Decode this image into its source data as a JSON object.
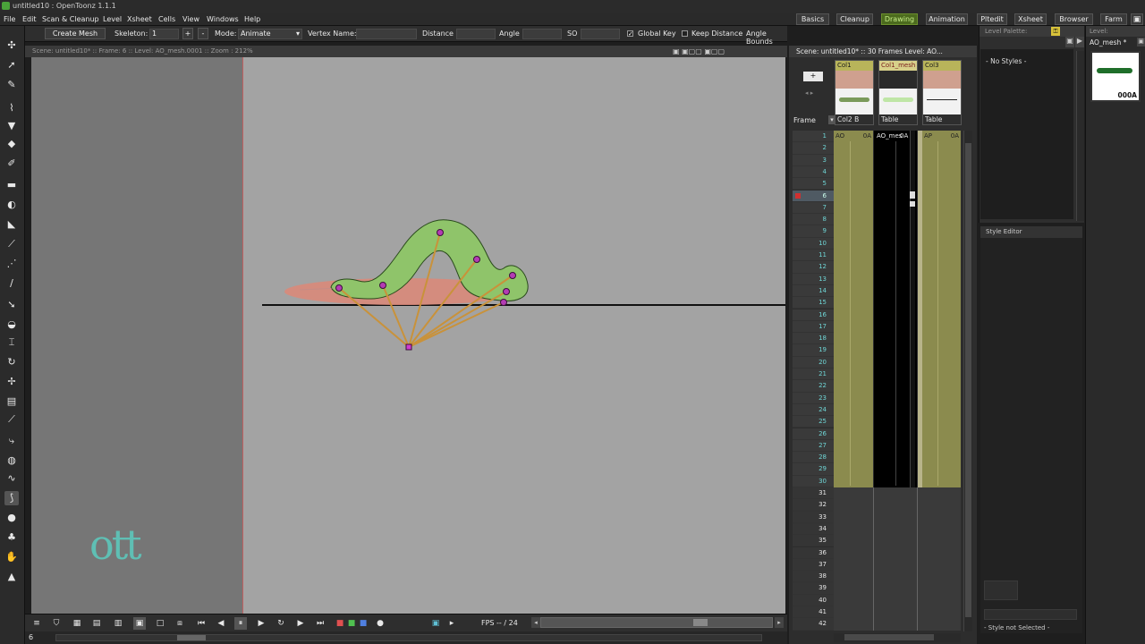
{
  "window": {
    "title": "untitled10 : OpenToonz 1.1.1"
  },
  "menu": [
    "File",
    "Edit",
    "Scan & Cleanup",
    "Level",
    "Xsheet",
    "Cells",
    "View",
    "Windows",
    "Help"
  ],
  "rooms": [
    {
      "label": "Basics",
      "active": false
    },
    {
      "label": "Cleanup",
      "active": false
    },
    {
      "label": "Drawing",
      "active": true
    },
    {
      "label": "Animation",
      "active": false
    },
    {
      "label": "Pltedit",
      "active": false
    },
    {
      "label": "Xsheet",
      "active": false
    },
    {
      "label": "Browser",
      "active": false
    },
    {
      "label": "Farm",
      "active": false
    }
  ],
  "tool_options": {
    "create_mesh": "Create Mesh",
    "skeleton_label": "Skeleton:",
    "skeleton_value": "1",
    "plus": "+",
    "minus": "-",
    "mode_label": "Mode:",
    "mode_value": "Animate",
    "vertex_name_label": "Vertex Name:",
    "distance_label": "Distance",
    "angle_label": "Angle",
    "so_label": "SO",
    "global_key_label": "Global Key",
    "global_key_checked": "✓",
    "keep_distance_label": "Keep Distance",
    "angle_bounds_label": "Angle Bounds"
  },
  "viewer": {
    "header": "Scene: untitled10*  ::  Frame: 6  ::  Level: AO_mesh.0001  ::  Zoom : 212%",
    "logo_text": "ott"
  },
  "playback": {
    "fps_label": "FPS -- / 24",
    "frame_field": "6"
  },
  "xsheet": {
    "header": "Scene: untitled10*  ::  30 Frames  Level: AO...",
    "frame_label": "Frame",
    "columns": [
      {
        "name": "Col1",
        "sub": "Col2   B",
        "cell_label": "AO",
        "cell_label2": "0A"
      },
      {
        "name": "Col1_mesh",
        "sub": "Table",
        "cell_label": "AO_mes",
        "cell_label2": "0A"
      },
      {
        "name": "Col3",
        "sub": "Table",
        "cell_label": "AP",
        "cell_label2": "0A"
      }
    ],
    "frames": [
      "1",
      "2",
      "3",
      "4",
      "5",
      "6",
      "7",
      "8",
      "9",
      "10",
      "11",
      "12",
      "13",
      "14",
      "15",
      "16",
      "17",
      "18",
      "19",
      "20",
      "21",
      "22",
      "23",
      "24",
      "25",
      "26",
      "27",
      "28",
      "29",
      "30",
      "31",
      "32",
      "33",
      "34",
      "35",
      "36",
      "37",
      "38",
      "39",
      "40",
      "41",
      "42"
    ],
    "current_frame": 6,
    "scene_frame_count": 30
  },
  "level_palette": {
    "header": "Level Palette:",
    "empty_text": "- No Styles -"
  },
  "style_editor": {
    "header": "Style Editor",
    "footer": "- Style not Selected -"
  },
  "level_strip": {
    "header": "Level:",
    "title": "AO_mesh *",
    "cell_name": "000A"
  },
  "colors": {
    "accent_room": "#4c6b1e",
    "worm_fill": "#8fc46a",
    "shadow_fill": "#d98a7a",
    "bone": "#c9923a",
    "joint": "#8a2a8a",
    "xsheet_cell": "#8b8b4e"
  }
}
